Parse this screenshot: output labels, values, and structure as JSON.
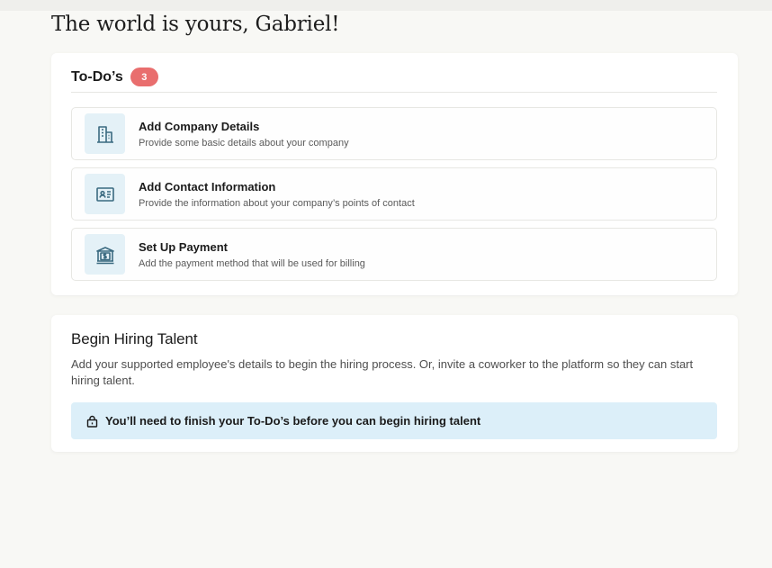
{
  "greeting": "The world is yours, Gabriel!",
  "todo": {
    "title": "To-Do’s",
    "count": "3",
    "items": [
      {
        "title": "Add Company Details",
        "description": "Provide some basic details about your company",
        "icon": "building-icon"
      },
      {
        "title": "Add Contact Information",
        "description": "Provide the information about your company’s points of contact",
        "icon": "contact-card-icon"
      },
      {
        "title": "Set Up Payment",
        "description": "Add the payment method that will be used for billing",
        "icon": "bank-payment-icon"
      }
    ]
  },
  "hiring": {
    "title": "Begin Hiring Talent",
    "description": "Add your supported employee's details to begin the hiring process. Or, invite a coworker to the platform so they can start hiring talent.",
    "notice": "You’ll need to finish your To-Do’s before you can begin hiring talent",
    "notice_icon": "lock-icon"
  },
  "colors": {
    "background": "#f8f8f5",
    "card": "#ffffff",
    "badge": "#e96e6e",
    "icon_tile": "#e4f1f7",
    "icon_stroke": "#3a6a80",
    "notice_bg": "#dceff9"
  }
}
